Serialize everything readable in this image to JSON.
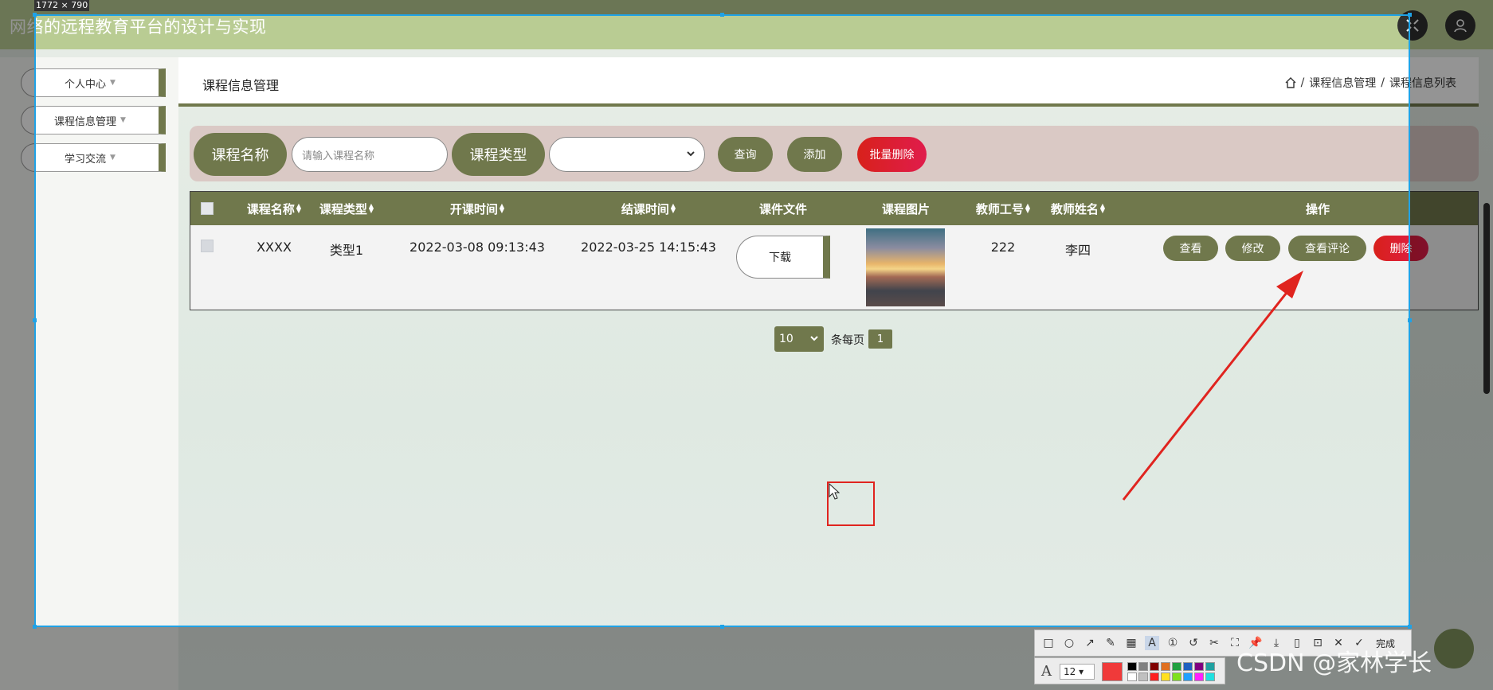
{
  "size_label": "1772 × 790",
  "app": {
    "title": "网络的远程教育平台的设计与实现"
  },
  "sidebar": {
    "items": [
      {
        "label": "个人中心"
      },
      {
        "label": "课程信息管理"
      },
      {
        "label": "学习交流"
      }
    ]
  },
  "content": {
    "title": "课程信息管理",
    "breadcrumb": [
      "课程信息管理",
      "课程信息列表"
    ]
  },
  "search": {
    "name_label": "课程名称",
    "name_placeholder": "请输入课程名称",
    "type_label": "课程类型",
    "type_value": "",
    "query_button": "查询",
    "add_button": "添加",
    "batch_delete_button": "批量删除"
  },
  "table": {
    "columns": [
      "课程名称",
      "课程类型",
      "开课时间",
      "结课时间",
      "课件文件",
      "课程图片",
      "教师工号",
      "教师姓名",
      "操作"
    ],
    "rows": [
      {
        "course_name": "XXXX",
        "course_type": "类型1",
        "start_time": "2022-03-08 09:13:43",
        "end_time": "2022-03-25 14:15:43",
        "file_button": "下载",
        "teacher_id": "222",
        "teacher_name": "李四",
        "actions": [
          "查看",
          "修改",
          "查看评论",
          "删除"
        ]
      }
    ]
  },
  "pagination": {
    "page_size": "10",
    "per_page_text": "条每页",
    "current_page": "1"
  },
  "capture_tool": {
    "done_label": "完成",
    "font_size": "12",
    "current_color": "#f03a3a",
    "palette": [
      "#000000",
      "#808080",
      "#800000",
      "#e07020",
      "#20a040",
      "#2060c0",
      "#800080",
      "#20a0a0",
      "#ffffff",
      "#c0c0c0",
      "#ff2020",
      "#ffe020",
      "#80e020",
      "#20a0ff",
      "#ff20ff",
      "#20e0e0"
    ]
  },
  "watermark": "CSDN @家林学长"
}
